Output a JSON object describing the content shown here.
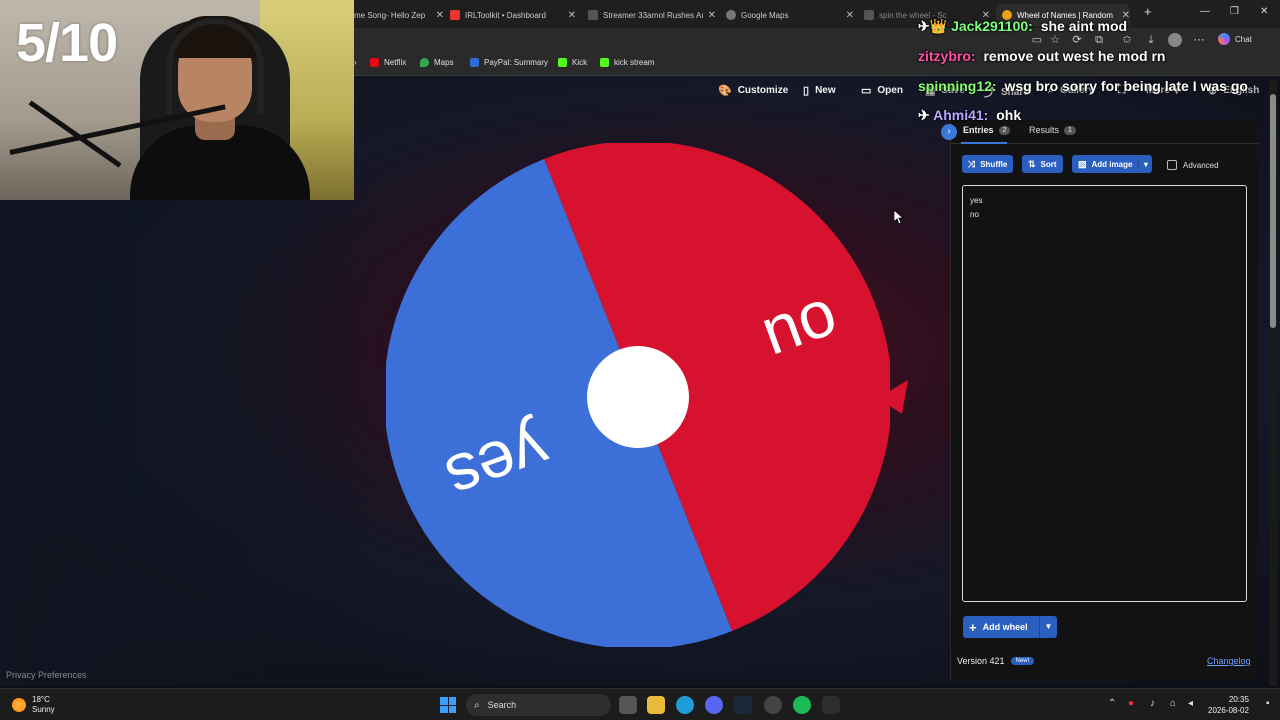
{
  "overlay": {
    "score": "5/10"
  },
  "browser": {
    "tabs": [
      {
        "title": "me Song- Hello Zep",
        "favicon_color": "#d33",
        "active": false
      },
      {
        "title": "IRLToolkit • Dashboard",
        "favicon_color": "#e33",
        "active": false
      },
      {
        "title": "Streamer 33arnol Rushes Aı",
        "favicon_color": "#777",
        "active": false
      },
      {
        "title": "Google Maps",
        "favicon_color": "#999",
        "active": false
      },
      {
        "title": "spin the wheel - Sc",
        "favicon_color": "#777",
        "active": false
      },
      {
        "title": "Wheel of Names | Random",
        "favicon_color": "#e8a317",
        "active": true
      }
    ],
    "new_tab": "+",
    "window_controls": {
      "minimize": "—",
      "maximize": "❐",
      "close": "✕"
    },
    "chat_button": "Chat",
    "bookmarks": [
      {
        "label": "Netflix",
        "color": "#e50914"
      },
      {
        "label": "Maps",
        "color": "#34a853"
      },
      {
        "label": "PayPal: Summary",
        "color": "#2b6cd4"
      },
      {
        "label": "Kick",
        "color": "#53fc18"
      },
      {
        "label": "kick stream",
        "color": "#53fc18"
      }
    ],
    "bookmark_leading": "›"
  },
  "app_nav": {
    "customize": "Customize",
    "new": "New",
    "open": "Open",
    "save": "Save",
    "share": "Share",
    "gallery": "Gallery",
    "more": "More",
    "language": "English"
  },
  "wheel": {
    "segments": [
      {
        "label": "yes",
        "color": "#3c6fd8"
      },
      {
        "label": "no",
        "color": "#d6122e"
      }
    ],
    "center_color": "#ffffff",
    "pointer_color": "#d6122e"
  },
  "sidebar": {
    "tabs": {
      "entries_label": "Entries",
      "entries_count": "2",
      "results_label": "Results",
      "results_count": "1"
    },
    "buttons": {
      "shuffle": "Shuffle",
      "sort": "Sort",
      "add_image": "Add image",
      "advanced": "Advanced"
    },
    "entries": [
      "yes",
      "no"
    ],
    "add_wheel": "Add wheel",
    "version": "Version 421",
    "new_badge": "New!",
    "changelog": "Changelog"
  },
  "page": {
    "privacy": "Privacy Preferences"
  },
  "chat": [
    {
      "prefix": "✈👑",
      "user": "Jack291100:",
      "message": "she aint mod",
      "color": "#7dff7d"
    },
    {
      "prefix": "",
      "user": "zitzybro:",
      "message": "remove out west he mod rn",
      "color": "#ff4fa3"
    },
    {
      "prefix": "",
      "user": "spinning12:",
      "message": "wsg bro sorry for being late I was go",
      "color": "#8aff6e"
    },
    {
      "prefix": "✈",
      "user": "Ahmi41:",
      "message": "ohk",
      "color": "#b9a7ff"
    }
  ],
  "taskbar": {
    "temperature": "18°C",
    "weather": "Sunny",
    "search": "Search",
    "time": "20:35",
    "date": "2026-08-02"
  }
}
